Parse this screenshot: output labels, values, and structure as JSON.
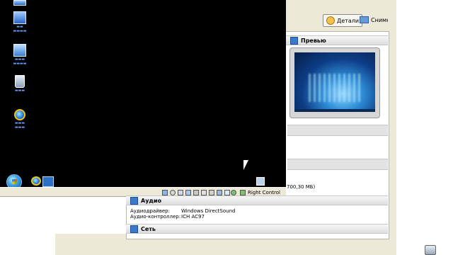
{
  "toolbar": {
    "details_label": "Детали",
    "snapshots_label": "Снимки"
  },
  "sections": {
    "preview_title": "Превью",
    "audio_title": "Аудио",
    "network_title": "Сеть"
  },
  "audio": {
    "driver_key": "Аудиодрайвер:",
    "driver_value": "Windows DirectSound",
    "controller_key": "Аудио-контроллер:",
    "controller_value": "ICH AC97"
  },
  "storage_fragment": "700,30 МБ)",
  "statusbar": {
    "host_key": "Right Control"
  },
  "colors": {
    "guest_background": "#000000",
    "host_window": "#ece9d8",
    "accent_blue": "#3e78c8"
  }
}
